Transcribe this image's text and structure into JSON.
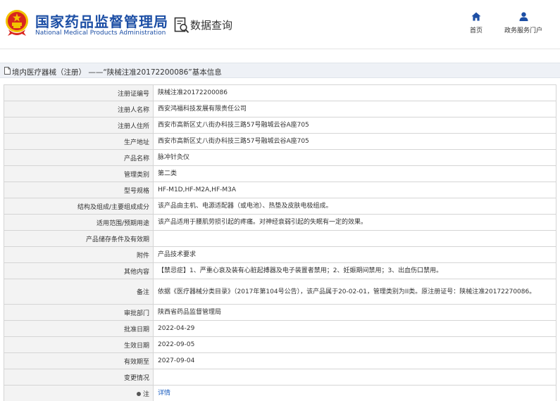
{
  "header": {
    "brand_cn": "国家药品监督管理局",
    "brand_en": "National Medical Products Administration",
    "query_label": "数据查询",
    "nav": [
      {
        "label": "首页",
        "icon": "home-icon"
      },
      {
        "label": "政务服务门户",
        "icon": "user-icon"
      }
    ]
  },
  "breadcrumb": {
    "text": "境内医疗器械（注册） ——“陕械注准20172200086”基本信息"
  },
  "details": {
    "rows": [
      {
        "label": "注册证编号",
        "value": "陕械注准20172200086"
      },
      {
        "label": "注册人名称",
        "value": "西安鸿福科技发展有限责任公司"
      },
      {
        "label": "注册人住所",
        "value": "西安市高新区丈八街办科技三路57号融城云谷A座705"
      },
      {
        "label": "生产地址",
        "value": "西安市高新区丈八街办科技三路57号融城云谷A座705"
      },
      {
        "label": "产品名称",
        "value": "脉冲针灸仪"
      },
      {
        "label": "管理类别",
        "value": "第二类"
      },
      {
        "label": "型号规格",
        "value": "HF-M1D,HF-M2A,HF-M3A"
      },
      {
        "label": "结构及组成/主要组成成分",
        "value": "该产品由主机、电源适配器（或电池）、热垫及皮肤电极组成。"
      },
      {
        "label": "适用范围/预期用途",
        "value": "该产品适用于腰肌劳损引起的疼痛。对神经衰弱引起的失眠有一定的效果。"
      },
      {
        "label": "产品储存条件及有效期",
        "value": ""
      },
      {
        "label": "附件",
        "value": "产品技术要求"
      },
      {
        "label": "其他内容",
        "value": "【禁忌症】1、严重心衰及装有心脏起搏器及电子装置者禁用；2、妊娠期间禁用；3、出血伤口禁用。"
      },
      {
        "label": "备注",
        "value": "依据《医疗器械分类目录》（2017年第104号公告），该产品属于20-02-01，管理类别为II类。原注册证号：陕械注准20172270086。"
      },
      {
        "label": "审批部门",
        "value": "陕西省药品监督管理局"
      },
      {
        "label": "批准日期",
        "value": "2022-04-29"
      },
      {
        "label": "生效日期",
        "value": "2022-09-05"
      },
      {
        "label": "有效期至",
        "value": "2027-09-04"
      },
      {
        "label": "变更情况",
        "value": ""
      },
      {
        "label": "注",
        "value": "详情"
      }
    ]
  },
  "colors": {
    "brand_blue": "#1d4fa5",
    "link_blue": "#1d5fc0",
    "emblem_red": "#d8261e",
    "emblem_gold": "#f2c200"
  }
}
